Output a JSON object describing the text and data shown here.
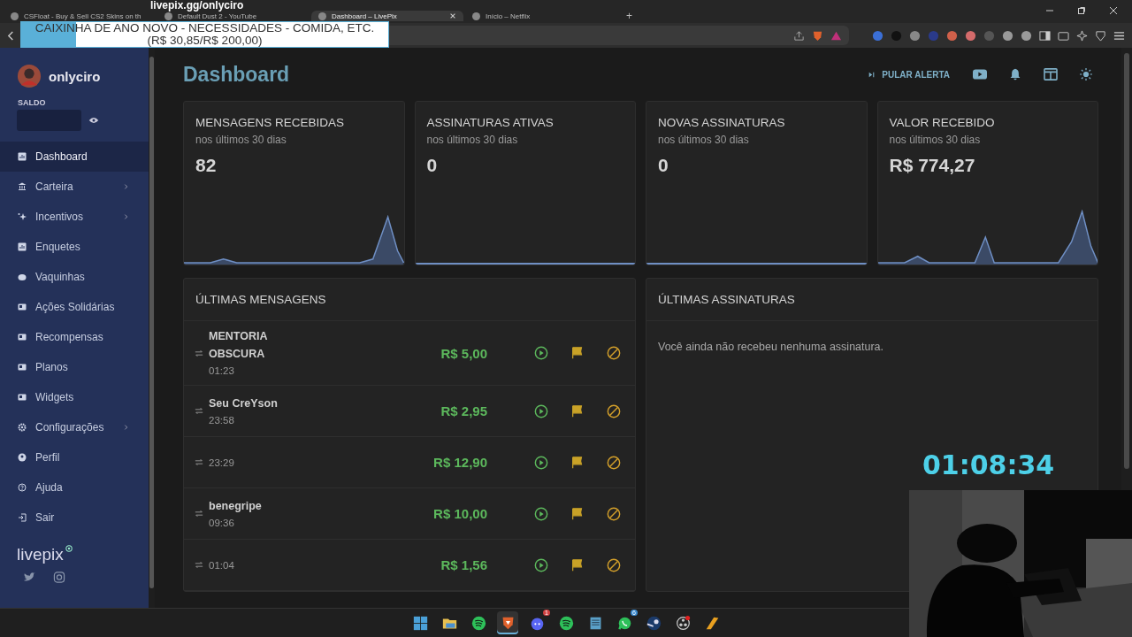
{
  "overlay": {
    "url": "livepix.gg/onlyciro",
    "goal": "CAIXINHA DE ANO NOVO - NECESSIDADES - COMIDA, ETC.",
    "progress": "(R$ 30,85/R$ 200,00)",
    "level": 0.15
  },
  "browser": {
    "tabs": [
      {
        "label": "CSFloat - Buy & Sell CS2 Skins on th",
        "selected": false
      },
      {
        "label": "Default Dust 2 - YouTube",
        "selected": false
      },
      {
        "label": "Dashboard – LivePix",
        "selected": true
      },
      {
        "label": "Início – Netflix",
        "selected": false
      }
    ],
    "new_tab": "+"
  },
  "sidebar": {
    "user": "onlyciro",
    "balance_label": "SALDO",
    "items": [
      {
        "label": "Dashboard",
        "selected": true,
        "expandable": false
      },
      {
        "label": "Carteira",
        "selected": false,
        "expandable": true
      },
      {
        "label": "Incentivos",
        "selected": false,
        "expandable": true
      },
      {
        "label": "Enquetes",
        "selected": false,
        "expandable": false
      },
      {
        "label": "Vaquinhas",
        "selected": false,
        "expandable": false
      },
      {
        "label": "Ações Solidárias",
        "selected": false,
        "expandable": false
      },
      {
        "label": "Recompensas",
        "selected": false,
        "expandable": false
      },
      {
        "label": "Planos",
        "selected": false,
        "expandable": false
      },
      {
        "label": "Widgets",
        "selected": false,
        "expandable": false
      },
      {
        "label": "Configurações",
        "selected": false,
        "expandable": true
      },
      {
        "label": "Perfil",
        "selected": false,
        "expandable": false
      },
      {
        "label": "Ajuda",
        "selected": false,
        "expandable": false
      },
      {
        "label": "Sair",
        "selected": false,
        "expandable": false
      }
    ],
    "logo": "livepix"
  },
  "header": {
    "title": "Dashboard",
    "skip_button": "PULAR ALERTA"
  },
  "stats": [
    {
      "title": "MENSAGENS RECEBIDAS",
      "subtitle": "nos últimos 30 dias",
      "value": "82"
    },
    {
      "title": "ASSINATURAS ATIVAS",
      "subtitle": "nos últimos 30 dias",
      "value": "0"
    },
    {
      "title": "NOVAS ASSINATURAS",
      "subtitle": "nos últimos 30 dias",
      "value": "0"
    },
    {
      "title": "VALOR RECEBIDO",
      "subtitle": "nos últimos 30 dias",
      "value": "R$ 774,27"
    }
  ],
  "messages": {
    "title": "ÚLTIMAS MENSAGENS",
    "rows": [
      {
        "name": "MENTORIA OBSCURA",
        "time": "01:23",
        "amount": "R$ 5,00"
      },
      {
        "name": "Seu CreYson",
        "time": "23:58",
        "amount": "R$ 2,95"
      },
      {
        "time": "23:29",
        "amount": "R$ 12,90"
      },
      {
        "name": "benegripe",
        "time": "09:36",
        "amount": "R$ 10,00"
      },
      {
        "time": "01:04",
        "amount": "R$ 1,56"
      }
    ]
  },
  "subscriptions": {
    "title": "ÚLTIMAS ASSINATURAS",
    "empty_text": "Você ainda não recebeu nenhuma assinatura."
  },
  "timer": "01:08:34",
  "taskbar": [
    {
      "selected": false
    },
    {
      "selected": false
    },
    {
      "selected": false
    },
    {
      "selected": true
    },
    {
      "selected": false,
      "badge": "1"
    },
    {
      "selected": false
    },
    {
      "selected": false
    },
    {
      "selected": false,
      "badge": "6"
    },
    {
      "selected": false
    },
    {
      "selected": false
    },
    {
      "selected": false
    }
  ]
}
